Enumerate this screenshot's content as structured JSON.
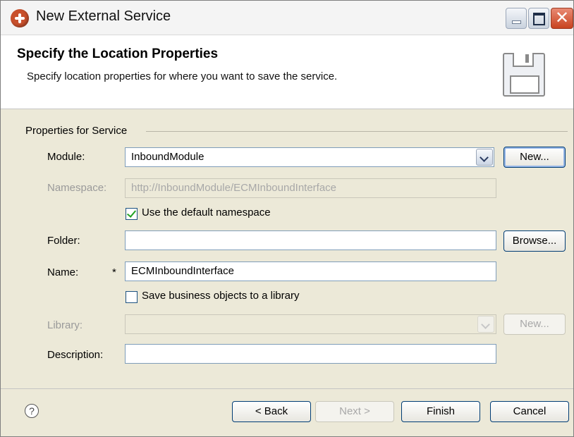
{
  "window": {
    "title": "New External Service",
    "close_glyph": "✕"
  },
  "banner": {
    "title": "Specify the Location Properties",
    "description": "Specify location properties for where you want to save the service.",
    "icon": "save-disk-icon"
  },
  "group": {
    "label": "Properties for Service"
  },
  "form": {
    "module": {
      "label": "Module:",
      "value": "InboundModule",
      "new_button": "New..."
    },
    "namespace": {
      "label": "Namespace:",
      "value": "http://InboundModule/ECMInboundInterface"
    },
    "default_namespace": {
      "label": "Use the default namespace",
      "checked": true
    },
    "folder": {
      "label": "Folder:",
      "value": "",
      "browse_button": "Browse..."
    },
    "name": {
      "label": "Name:",
      "required_marker": "*",
      "value": "ECMInboundInterface"
    },
    "save_bo": {
      "label": "Save business objects to a library",
      "checked": false
    },
    "library": {
      "label": "Library:",
      "value": "",
      "new_button": "New..."
    },
    "description": {
      "label": "Description:",
      "value": ""
    }
  },
  "footer": {
    "help_glyph": "?",
    "back": "< Back",
    "next": "Next >",
    "finish": "Finish",
    "cancel": "Cancel"
  }
}
